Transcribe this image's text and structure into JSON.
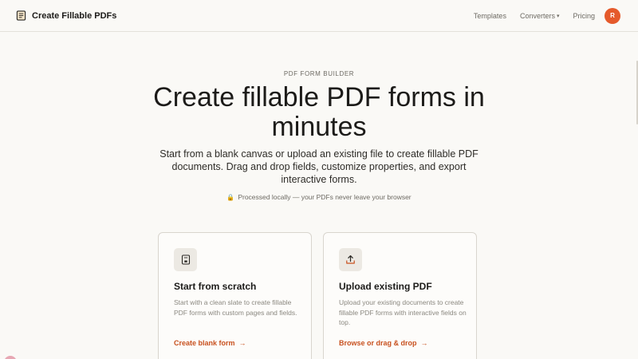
{
  "brand": {
    "name": "Create Fillable PDFs",
    "icon": "document-icon"
  },
  "nav": {
    "templates": "Templates",
    "converters": "Converters",
    "converters_chevron": "▾",
    "pricing": "Pricing",
    "avatar_initial": "R"
  },
  "hero": {
    "eyebrow": "PDF FORM BUILDER",
    "title": "Create fillable PDF forms in minutes",
    "subtitle": "Start from a blank canvas or upload an existing file to create fillable PDF documents. Drag and drop fields, customize properties, and export interactive forms.",
    "privacy_note": "Processed locally — your PDFs never leave your browser",
    "privacy_icon": "lock-icon"
  },
  "cards": [
    {
      "title": "Start from scratch",
      "description": "Start with a clean slate to create fillable PDF forms with custom pages and fields.",
      "link": "Create blank form",
      "icon": "blank-document-icon"
    },
    {
      "title": "Upload existing PDF",
      "description": "Upload your existing documents to create fillable PDF forms with interactive fields on top.",
      "link": "Browse or drag & drop",
      "icon": "upload-icon"
    }
  ],
  "colors": {
    "accent": "#e55a2b",
    "link": "#c8511f",
    "background": "#faf9f6",
    "text": "#1c1b19",
    "muted": "#8b8880"
  }
}
